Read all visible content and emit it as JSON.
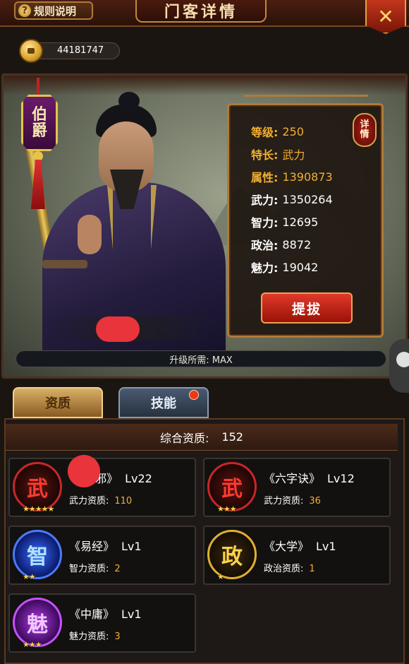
{
  "header": {
    "rules_label": "规则说明",
    "rules_icon": "question-icon",
    "title": "门客详情",
    "close_icon": "close-icon"
  },
  "currency": {
    "icon": "coin-icon",
    "value": "44181747"
  },
  "character": {
    "rank_chars": [
      "伯",
      "爵"
    ],
    "upgrade_text": "升级所需: MAX"
  },
  "stats": {
    "level": {
      "label": "等级:",
      "value": "250"
    },
    "specialty": {
      "label": "特长:",
      "value": "武力"
    },
    "attribute": {
      "label": "属性:",
      "value": "1390873"
    },
    "force": {
      "label": "武力:",
      "value": "1350264"
    },
    "intellect": {
      "label": "智力:",
      "value": "12695"
    },
    "politics": {
      "label": "政治:",
      "value": "8872"
    },
    "charm": {
      "label": "魅力:",
      "value": "19042"
    },
    "detail_chars": [
      "详",
      "情"
    ],
    "promote_label": "提拔"
  },
  "tabs": [
    {
      "label": "资质",
      "active": true
    },
    {
      "label": "技能",
      "active": false,
      "badge": true
    }
  ],
  "total": {
    "label": "综合资质:",
    "value": "152"
  },
  "books": [
    {
      "icon_char": "武",
      "icon": "force-icon",
      "title": "《   莫邪》",
      "level": "Lv22",
      "stat_label": "武力资质:",
      "stat_value": "110",
      "stars": "★★★★★"
    },
    {
      "icon_char": "武",
      "icon": "force-icon",
      "title": "《六字诀》",
      "level": "Lv12",
      "stat_label": "武力资质:",
      "stat_value": "36",
      "stars": "★★★"
    },
    {
      "icon_char": "智",
      "icon": "intellect-icon",
      "title": "《易经》",
      "level": "Lv1",
      "stat_label": "智力资质:",
      "stat_value": "2",
      "stars": "★★"
    },
    {
      "icon_char": "政",
      "icon": "politics-icon",
      "title": "《大学》",
      "level": "Lv1",
      "stat_label": "政治资质:",
      "stat_value": "1",
      "stars": "★"
    },
    {
      "icon_char": "魅",
      "icon": "charm-icon",
      "title": "《中庸》",
      "level": "Lv1",
      "stat_label": "魅力资质:",
      "stat_value": "3",
      "stars": "★★★"
    }
  ],
  "colors": {
    "accent_gold": "#f2b030",
    "promote_red": "#e03a2a",
    "frame_brown": "#b07a3a"
  }
}
